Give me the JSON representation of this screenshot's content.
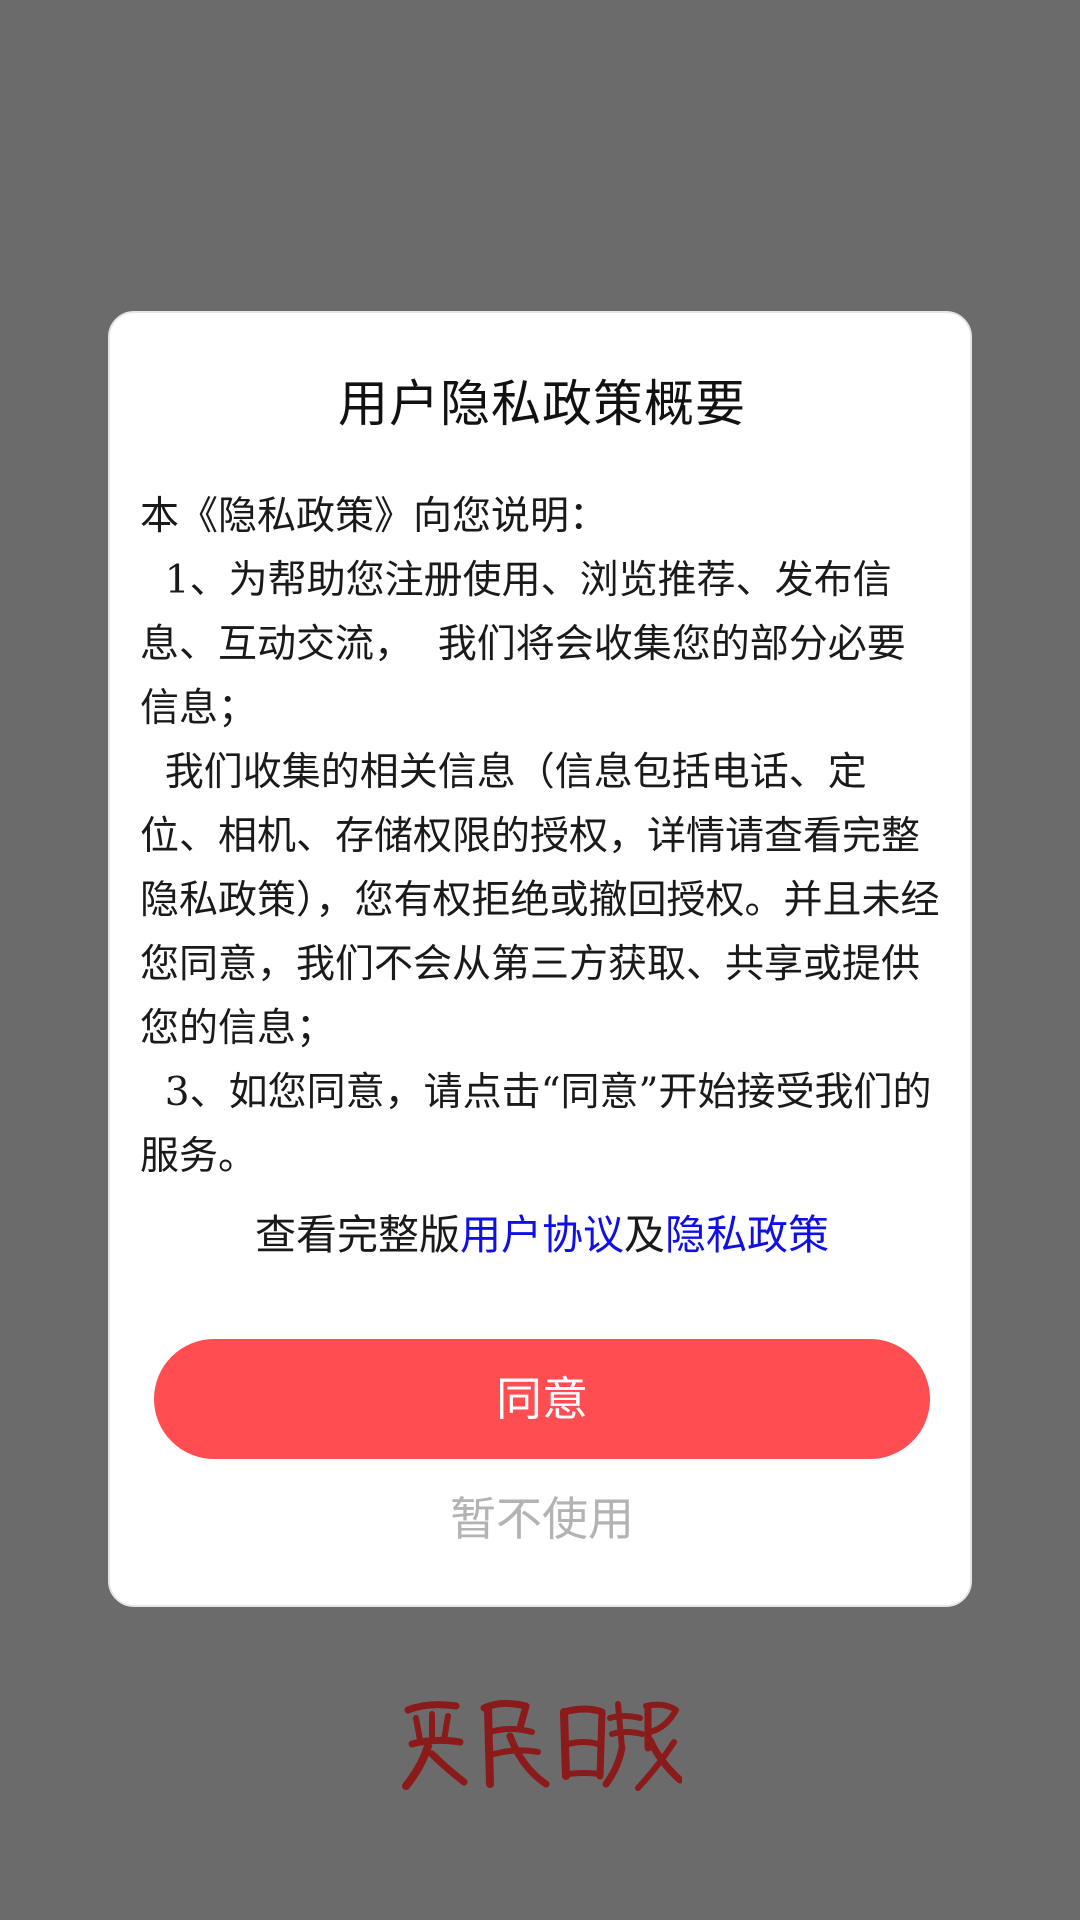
{
  "dialog": {
    "title": "用户隐私政策概要",
    "paragraphs": [
      "本《隐私政策》向您说明：",
      "  1、为帮助您注册使用、浏览推荐、发布信息、互动交流，  我们将会收集您的部分必要信息；",
      "  我们收集的相关信息（信息包括电话、定位、相机、存储权限的授权，详情请查看完整隐私政策），您有权拒绝或撤回授权。并且未经您同意，我们不会从第三方获取、共享或提供您的信息；",
      "  3、如您同意，请点击“同意”开始接受我们的服务。"
    ],
    "links_prefix": "查看完整版",
    "user_agreement_link": "用户协议",
    "links_conjunction": "及",
    "privacy_policy_link": "隐私政策",
    "agree_label": "同意",
    "decline_label": "暂不使用"
  },
  "brand": {
    "logo_text": "農民日報",
    "logo_color": "#8b1a1a"
  },
  "colors": {
    "backdrop": "#6b6b6b",
    "accent": "#ff4d52",
    "link": "#1010e6",
    "muted": "#b3b3b3"
  }
}
